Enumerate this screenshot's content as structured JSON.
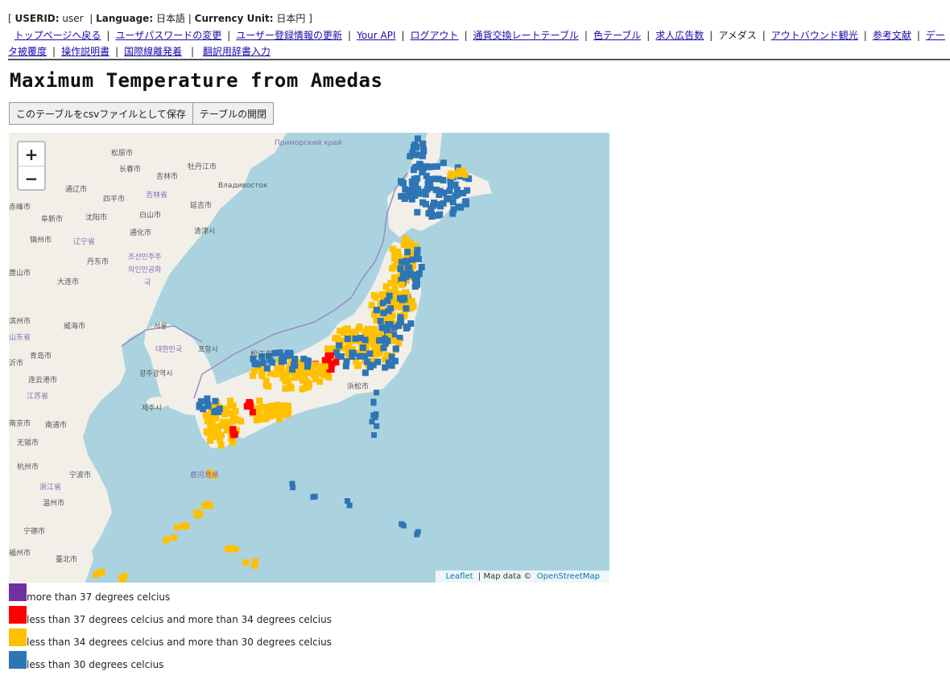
{
  "header": {
    "userid_label": "USERID:",
    "userid_value": "user",
    "language_label": "Language:",
    "language_value": "日本語",
    "currency_label": "Currency Unit:",
    "currency_value": "日本円"
  },
  "nav": {
    "items": [
      "トップページへ戻る",
      "ユーザパスワードの変更",
      "ユーザー登録情報の更新",
      "Your API",
      "ログアウト",
      "通貨交換レートテーブル",
      "色テーブル",
      "求人広告数",
      "アメダス",
      "アウトバウンド観光",
      "参考文献",
      "データ被覆度",
      "操作説明書",
      "国際線離発着",
      "翻訳用辞書入力"
    ]
  },
  "page": {
    "title": "Maximum Temperature from Amedas",
    "save_csv_label": "このテーブルをcsvファイルとして保存",
    "toggle_table_label": "テーブルの開閉"
  },
  "map": {
    "zoom_in": "+",
    "zoom_out": "−",
    "attribution_leaflet": "Leaflet",
    "attribution_text": "| Map data ©",
    "attribution_osm": "OpenStreetMap",
    "labels": {
      "primorsky": "Приморский край",
      "vladivostok": "Владивосток",
      "songyuan": "松原市",
      "changchun": "长春市",
      "jilin": "吉林市",
      "mudanjiang": "牡丹江市",
      "tonghua": "通辽市",
      "siping": "四平市",
      "jilin_prov": "吉林省",
      "yanji": "延吉市",
      "chifeng": "赤峰市",
      "fuxin": "阜新市",
      "shenyang": "沈阳市",
      "baishan": "白山市",
      "tonghua2": "通化市",
      "qingjin": "清津시",
      "jinzhou": "锦州市",
      "liaoning": "辽宁省",
      "dandong": "丹东市",
      "nk1": "조선민주주",
      "nk2": "의인민공화",
      "nk3": "국",
      "tangshan": "唐山市",
      "dalian": "大连市",
      "binzhou": "滨州市",
      "weihai": "威海市",
      "shandong": "山东省",
      "seoul": "서울",
      "sk": "대한민국",
      "pohang": "포항시",
      "yishi": "沂市",
      "qingdao": "青岛市",
      "gwangju": "광주광역시",
      "lianyungang": "连云港市",
      "jiangsu": "江苏省",
      "jeju": "제주시",
      "nanjing": "南京市",
      "nantong": "南通市",
      "wuxi": "无锡市",
      "hangzhou": "杭州市",
      "ningbo": "宁波市",
      "zhejiang": "浙江省",
      "wenzhou": "温州市",
      "ningde": "宁德市",
      "taipei": "臺北市",
      "fuzhou": "福州市",
      "hamamatsu": "浜松市",
      "matsue": "松江市",
      "kagoshima": "鹿児島県"
    }
  },
  "legend": [
    {
      "label": "more than 37 degrees celcius",
      "color": "#7030a0"
    },
    {
      "label": "less than 37 degrees celcius and more than 34 degrees celcius",
      "color": "#ff0000"
    },
    {
      "label": "less than 34 degrees celcius and more than 30 degrees celcius",
      "color": "#ffc000"
    },
    {
      "label": "less than 30 degrees celcius",
      "color": "#2e75b6"
    }
  ],
  "colors": {
    "link": "#1a0dab",
    "sea": "#aad3df",
    "land": "#f2efe9"
  }
}
